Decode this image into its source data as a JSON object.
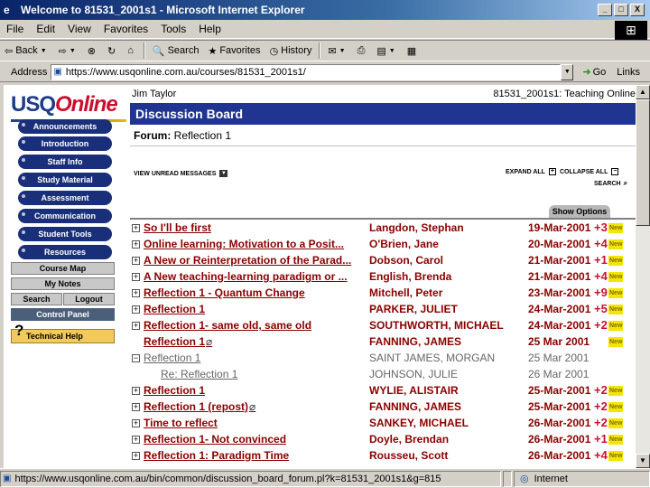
{
  "window": {
    "title": "Welcome to 81531_2001s1 - Microsoft Internet Explorer",
    "min": "_",
    "max": "□",
    "close": "X"
  },
  "menubar": {
    "items": [
      "File",
      "Edit",
      "View",
      "Favorites",
      "Tools",
      "Help"
    ]
  },
  "toolbar": {
    "back": "Back",
    "search": "Search",
    "favorites": "Favorites",
    "history": "History"
  },
  "address": {
    "label": "Address",
    "url": "https://www.usqonline.com.au/courses/81531_2001s1/",
    "go": "Go",
    "links": "Links"
  },
  "status": {
    "text": "https://www.usqonline.com.au/bin/common/discussion_board_forum.pl?k=81531_2001s1&g=815",
    "zone": "Internet"
  },
  "logo": {
    "part1": "USQ",
    "part2": "Online"
  },
  "nav": {
    "items": [
      "Announcements",
      "Introduction",
      "Staff Info",
      "Study Material",
      "Assessment",
      "Communication",
      "Student Tools",
      "Resources"
    ],
    "course_map": "Course Map",
    "my_notes": "My Notes",
    "search": "Search",
    "logout": "Logout",
    "control_panel": "Control Panel",
    "tech_help": "Technical Help"
  },
  "page": {
    "user": "Jim Taylor",
    "course": "81531_2001s1: Teaching Online",
    "header": "Discussion Board",
    "forum_label": "Forum:",
    "forum_name": "Reflection 1",
    "view_unread": "VIEW UNREAD MESSAGES",
    "expand_all": "EXPAND ALL",
    "collapse_all": "COLLAPSE ALL",
    "search": "SEARCH",
    "show_options": "Show Options",
    "new_badge": "New"
  },
  "threads": [
    {
      "exp": "+",
      "subject": "So I'll be first",
      "author": "Langdon, Stephan",
      "date": "19-Mar-2001",
      "count": "+3",
      "new": true
    },
    {
      "exp": "+",
      "subject": "Online learning: Motivation to a Posit...",
      "author": "O'Brien, Jane",
      "date": "20-Mar-2001",
      "count": "+4",
      "new": true
    },
    {
      "exp": "+",
      "subject": "A New or Reinterpretation of the Parad...",
      "author": "Dobson, Carol",
      "date": "21-Mar-2001",
      "count": "+1",
      "new": true
    },
    {
      "exp": "+",
      "subject": " A New teaching-learning paradigm or ...",
      "author": "English, Brenda",
      "date": "21-Mar-2001",
      "count": "+4",
      "new": true
    },
    {
      "exp": "+",
      "subject": "Reflection 1 - Quantum Change",
      "author": "Mitchell, Peter",
      "date": "23-Mar-2001",
      "count": "+9",
      "new": true
    },
    {
      "exp": "+",
      "subject": "Reflection 1",
      "author": "PARKER, JULIET",
      "date": "24-Mar-2001",
      "count": "+5",
      "new": true
    },
    {
      "exp": "+",
      "subject": "Reflection 1- same old, same old",
      "author": "SOUTHWORTH, MICHAEL",
      "date": "24-Mar-2001",
      "count": "+2",
      "new": true
    },
    {
      "exp": "",
      "subject": "Reflection 1",
      "clip": true,
      "author": "FANNING, JAMES",
      "date": "25 Mar 2001",
      "count": "",
      "new": true
    },
    {
      "exp": "−",
      "subject": "Reflection 1",
      "author": "SAINT JAMES, MORGAN",
      "date": "25 Mar 2001",
      "count": "",
      "new": false,
      "read": true
    },
    {
      "exp": "",
      "subject": "Re: Reflection 1",
      "author": "JOHNSON, JULIE",
      "date": "26 Mar 2001",
      "count": "",
      "new": false,
      "read": true,
      "child": true
    },
    {
      "exp": "+",
      "subject": "Reflection 1",
      "author": "WYLIE, ALISTAIR",
      "date": "25-Mar-2001",
      "count": "+2",
      "new": true
    },
    {
      "exp": "+",
      "subject": "Reflection 1 (repost)",
      "clip": true,
      "author": "FANNING, JAMES",
      "date": "25-Mar-2001",
      "count": "+2",
      "new": true
    },
    {
      "exp": "+",
      "subject": "Time to reflect",
      "author": "SANKEY, MICHAEL",
      "date": "26-Mar-2001",
      "count": "+2",
      "new": true
    },
    {
      "exp": "+",
      "subject": "Reflection 1- Not convinced",
      "author": "Doyle, Brendan",
      "date": "26-Mar-2001",
      "count": "+1",
      "new": true
    },
    {
      "exp": "+",
      "subject": "Reflection 1: Paradigm Time",
      "author": "Rousseu, Scott",
      "date": "26-Mar-2001",
      "count": "+4",
      "new": true
    }
  ]
}
